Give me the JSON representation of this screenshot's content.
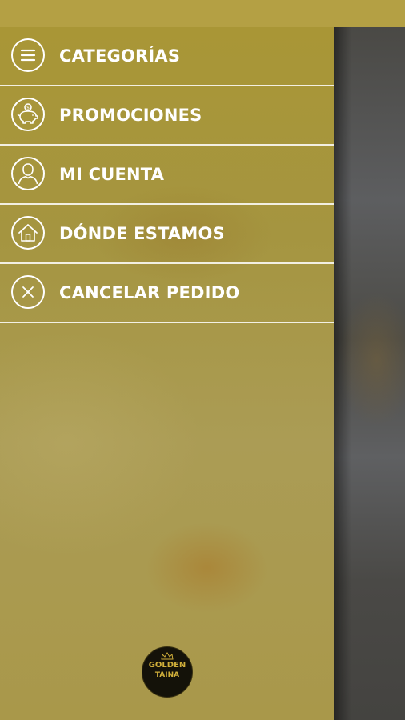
{
  "menu": {
    "items": [
      {
        "label": "CATEGORÍAS",
        "icon": "menu-lines-icon"
      },
      {
        "label": "PROMOCIONES",
        "icon": "piggy-bank-icon"
      },
      {
        "label": "MI CUENTA",
        "icon": "user-icon"
      },
      {
        "label": "DÓNDE ESTAMOS",
        "icon": "home-icon"
      },
      {
        "label": "CANCELAR PEDIDO",
        "icon": "close-icon"
      }
    ]
  },
  "logo": {
    "line1": "GOLDEN",
    "line2": "TAINA"
  },
  "colors": {
    "drawer": "#a99636",
    "status_bar": "#b4a044",
    "text": "#ffffff",
    "logo_bg": "#141209",
    "logo_text": "#cfae3a"
  }
}
